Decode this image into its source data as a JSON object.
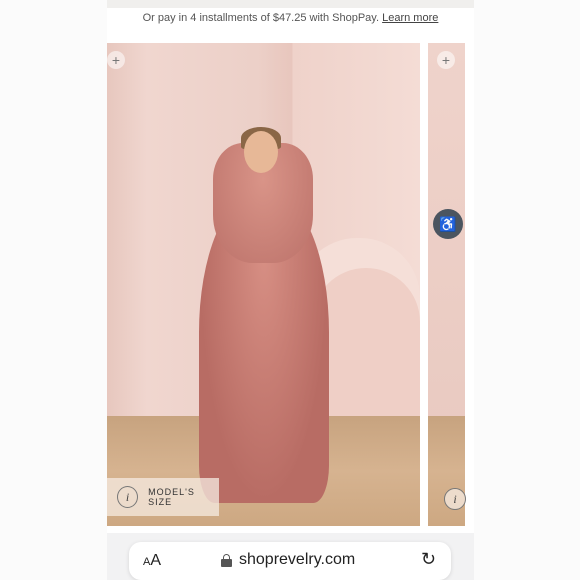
{
  "promo": {
    "text": "Or pay in 4 installments of $47.25 with ShopPay.",
    "link": "Learn more"
  },
  "gallery": {
    "zoom_icon": "plus",
    "accessibility_icon": "accessibility",
    "model_size_label": "MODEL'S SIZE",
    "info_icon_glyph": "i"
  },
  "browser": {
    "text_size_label": "AA",
    "url": "shoprevelry.com",
    "reload_glyph": "↻"
  }
}
